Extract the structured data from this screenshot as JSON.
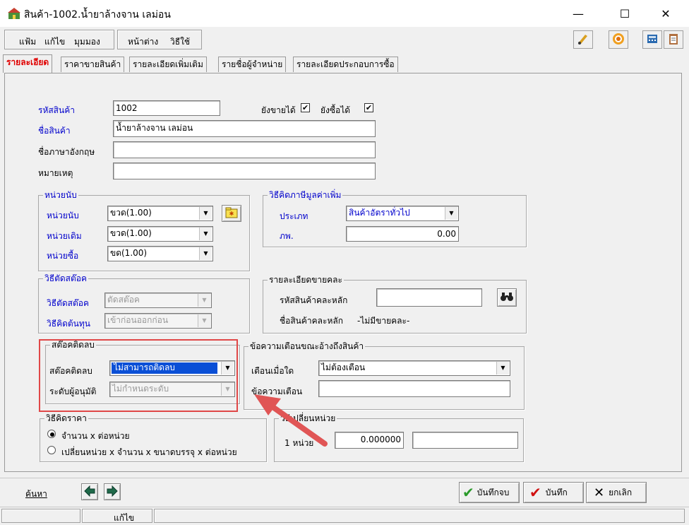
{
  "window": {
    "title": "สินค้า-1002.น้ำยาล้างจาน เลม่อน",
    "minimize_icon": "—",
    "maximize_icon": "☐",
    "close_icon": "✕"
  },
  "menu": {
    "items": [
      "แฟ้ม",
      "แก้ไข",
      "มุมมอง",
      "หน้าต่าง",
      "วิธีใช้"
    ]
  },
  "toolbar": {
    "icons": [
      "phone-icon",
      "target-icon",
      "calculator-icon",
      "clipboard-icon"
    ]
  },
  "tabs": [
    {
      "label": "รายละเอียด",
      "active": true
    },
    {
      "label": "ราคาขายสินค้า",
      "active": false
    },
    {
      "label": "รายละเอียดเพิ่มเติม",
      "active": false
    },
    {
      "label": "รายชื่อผู้จำหน่าย",
      "active": false
    },
    {
      "label": "รายละเอียดประกอบการซื้อ",
      "active": false
    }
  ],
  "form": {
    "product_code_label": "รหัสสินค้า",
    "product_code": "1002",
    "can_sell_label": "ยังขายได้",
    "can_sell": true,
    "can_buy_label": "ยังซื้อได้",
    "can_buy": true,
    "product_name_label": "ชื่อสินค้า",
    "product_name": "น้ำยาล้างจาน เลม่อน",
    "english_name_label": "ชื่อภาษาอังกฤษ",
    "english_name": "",
    "remark_label": "หมายเหตุ",
    "remark": ""
  },
  "units_group": {
    "title": "หน่วยนับ",
    "unit_label": "หน่วยนับ",
    "unit_value": "ขวด(1.00)",
    "sell_unit_label": "หน่วยเดิม",
    "sell_unit_value": "ขวด(1.00)",
    "buy_unit_label": "หน่วยซื้อ",
    "buy_unit_value": "ขด(1.00)"
  },
  "vat_group": {
    "title": "วิธีคิดภาษีมูลค่าเพิ่ม",
    "type_label": "ประเภท",
    "type_value": "สินค้าอัตราทั่วไป",
    "rate_label": "ภพ.",
    "rate_value": "0.00"
  },
  "stock_cut_group": {
    "title": "วิธีตัดสต๊อค",
    "method_label": "วิธีตัดสต๊อค",
    "method_value": "ตัดสต๊อค",
    "cost_label": "วิธีคิดต้นทุน",
    "cost_value": "เข้าก่อนออกก่อน"
  },
  "assortment_group": {
    "title": "รายละเอียดขายคละ",
    "main_code_label": "รหัสสินค้าคละหลัก",
    "main_code_value": "",
    "main_name_label": "ชื่อสินค้าคละหลัก",
    "main_name_value": "-ไม่มีขายคละ-"
  },
  "negative_stock_group": {
    "title": "สต๊อคติดลบ",
    "stock_label": "สต๊อคติดลบ",
    "stock_value": "ไม่สามารถติดลบ",
    "approver_label": "ระดับผู้อนุมัติ",
    "approver_value": "ไม่กำหนดระดับ"
  },
  "warning_group": {
    "title": "ข้อความเตือนขณะอ้างถึงสินค้า",
    "when_label": "เตือนเมื่อใด",
    "when_value": "ไม่ต้องเตือน",
    "message_label": "ข้อความเตือน",
    "message_value": ""
  },
  "price_group": {
    "title": "วิธีคิดราคา",
    "option1": "จำนวน x ต่อหน่วย",
    "option2": "เปลี่ยนหน่วย x จำนวน x ขนาดบรรจุ x ต่อหน่วย",
    "selected": 1
  },
  "unit_change_group": {
    "title": "วิธีเปลี่ยนหน่วย",
    "one_unit_label": "1 หน่วย",
    "factor_value": "0.000000",
    "extra_value": ""
  },
  "bottom": {
    "search_link": "ค้นหา",
    "save_close_label": "บันทึกจบ",
    "save_label": "บันทึก",
    "cancel_label": "ยกเลิก"
  },
  "status": {
    "mode": "แก้ไข"
  },
  "colors": {
    "highlight_box": "#e04848",
    "arrow": "#e05555",
    "selected_combo": "#0a4fd6",
    "label_blue": "#0000cc",
    "active_tab": "#e00000"
  }
}
